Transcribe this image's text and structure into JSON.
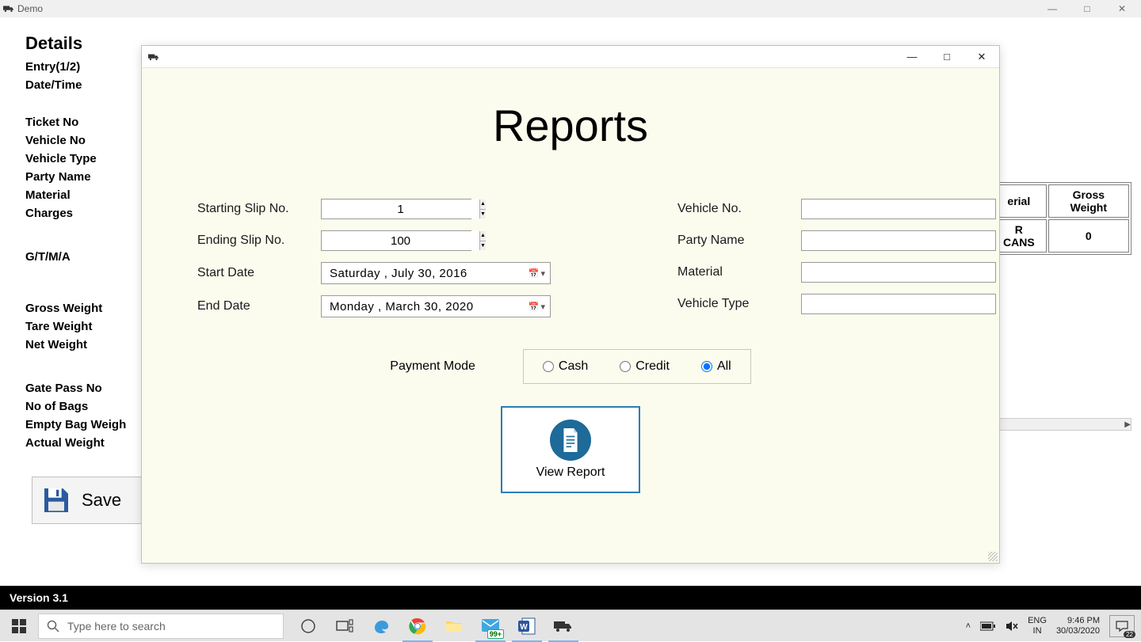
{
  "outer_window": {
    "title": "Demo"
  },
  "details": {
    "heading": "Details",
    "items1": [
      "Entry(1/2)",
      "Date/Time"
    ],
    "items2": [
      "Ticket No",
      "Vehicle No",
      "Vehicle Type",
      "Party Name",
      "Material",
      "Charges"
    ],
    "items3": [
      "G/T/M/A"
    ],
    "items4": [
      "Gross Weight",
      "Tare Weight",
      "Net Weight"
    ],
    "items5": [
      "Gate Pass No",
      "No of Bags",
      "Empty Bag Weigh",
      "Actual Weight"
    ]
  },
  "save_button": "Save",
  "bg_table": {
    "headers": [
      "erial",
      "Gross Weight"
    ],
    "row": [
      "R CANS",
      "0"
    ]
  },
  "modal": {
    "heading": "Reports",
    "labels": {
      "start_slip": "Starting Slip No.",
      "end_slip": "Ending Slip No.",
      "start_date": "Start Date",
      "end_date": "End Date",
      "vehicle_no": "Vehicle No.",
      "party_name": "Party Name",
      "material": "Material",
      "vehicle_type": "Vehicle Type",
      "payment_mode": "Payment Mode"
    },
    "values": {
      "start_slip": "1",
      "end_slip": "100",
      "start_date": "Saturday  ,      July      30, 2016",
      "end_date": "Monday   ,    March    30, 2020",
      "vehicle_no": "",
      "party_name": "",
      "material": "",
      "vehicle_type": ""
    },
    "payment_options": {
      "cash": "Cash",
      "credit": "Credit",
      "all": "All",
      "selected": "all"
    },
    "view_report": "View Report"
  },
  "version_bar": "Version 3.1",
  "taskbar": {
    "search_placeholder": "Type here to search",
    "mail_badge": "99+",
    "lang1": "ENG",
    "lang2": "IN",
    "time": "9:46 PM",
    "date": "30/03/2020",
    "notif_count": "22"
  }
}
